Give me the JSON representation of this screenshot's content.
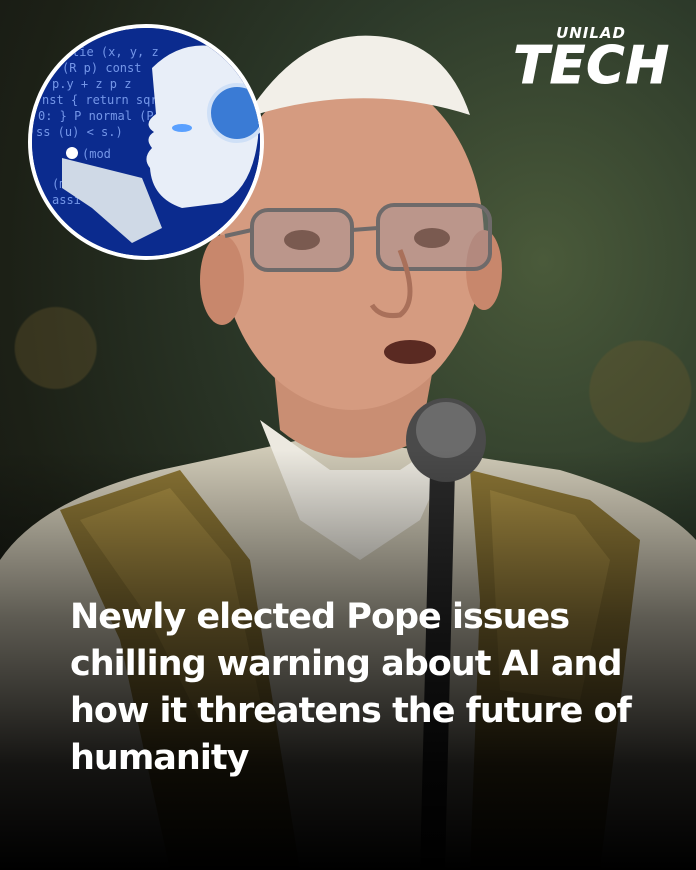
{
  "brand": {
    "top": "UNILAD",
    "main": "TECH"
  },
  "headline": "Newly elected Pope issues chilling warning about AI and how it threatens the future of humanity",
  "inset": {
    "code_lines": [
      "tie (x, y, z",
      "(R p) const",
      "p.y + z p z",
      "nst { return sqrt",
      "0: } P normal (P p",
      "ss (u) < s.)",
      "(mod",
      "(mod",
      "assi"
    ]
  },
  "colors": {
    "text": "#ffffff",
    "inset_bg": "#0a2a8a"
  }
}
